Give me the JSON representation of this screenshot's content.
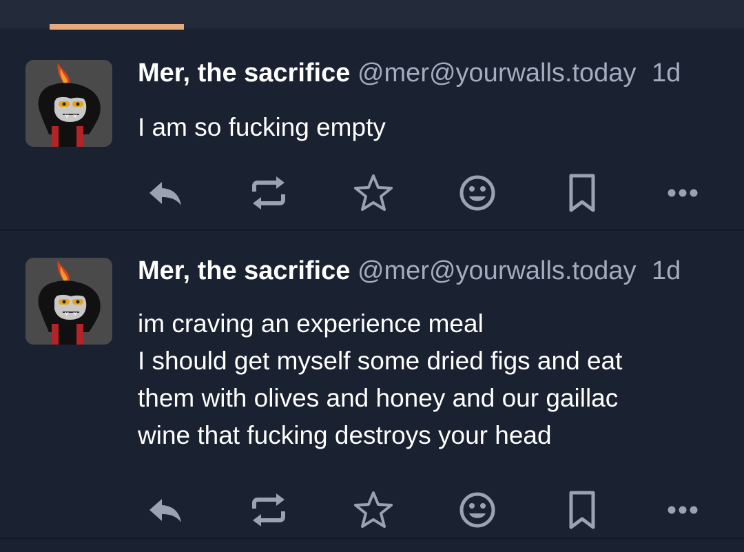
{
  "colors": {
    "background": "#1a2130",
    "tabbar": "#232b3b",
    "tab_indicator": "#e6a97c",
    "text": "#ffffff",
    "muted": "#a4adbd",
    "icon": "#9ba3b3"
  },
  "posts": [
    {
      "display_name": "Mer, the sacrifice",
      "handle": "@mer@yourwalls.today",
      "time": "1d",
      "content_lines": [
        "I am so fucking empty"
      ]
    },
    {
      "display_name": "Mer, the sacrifice",
      "handle": "@mer@yourwalls.today",
      "time": "1d",
      "content_lines": [
        "im craving an experience meal",
        "I should get myself some dried figs and eat",
        "them with olives and honey and our gaillac",
        "wine that fucking destroys your head"
      ]
    }
  ],
  "action_icons": [
    "reply-icon",
    "boost-icon",
    "star-icon",
    "emoji-icon",
    "bookmark-icon",
    "more-icon"
  ]
}
